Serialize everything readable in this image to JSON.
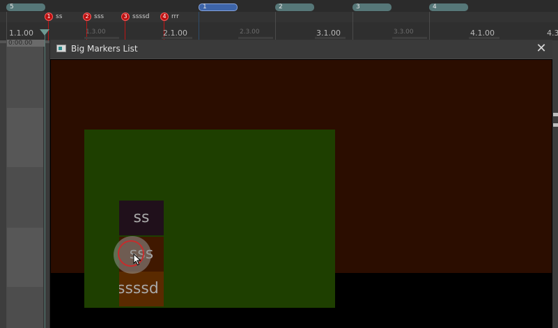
{
  "timeline": {
    "regions": [
      {
        "label": "5",
        "selected": false
      },
      {
        "label": "1",
        "selected": true
      },
      {
        "label": "2",
        "selected": false
      },
      {
        "label": "3",
        "selected": false
      },
      {
        "label": "4",
        "selected": false
      }
    ],
    "markers": [
      {
        "num": "1",
        "name": "ss"
      },
      {
        "num": "2",
        "name": "sss"
      },
      {
        "num": "3",
        "name": "ssssd"
      },
      {
        "num": "4",
        "name": "rrr"
      }
    ],
    "ruler_major": [
      "1.1.00",
      "2.1.00",
      "3.1.00",
      "4.1.00",
      "4.3"
    ],
    "ruler_minor": [
      "1.3.00",
      "2.3.00",
      "3.3.00"
    ],
    "time_readout": "0:00.00"
  },
  "dialog": {
    "title": "Big Markers List",
    "close_icon": "close-icon",
    "markers": [
      "ss",
      "sss",
      "ssssd"
    ]
  },
  "colors": {
    "marker_red": "#bb1010",
    "region_teal": "#567778",
    "region_selected": "#3d64a8",
    "content_bg": "#2b0d00",
    "panel_green": "#1e3f00"
  }
}
